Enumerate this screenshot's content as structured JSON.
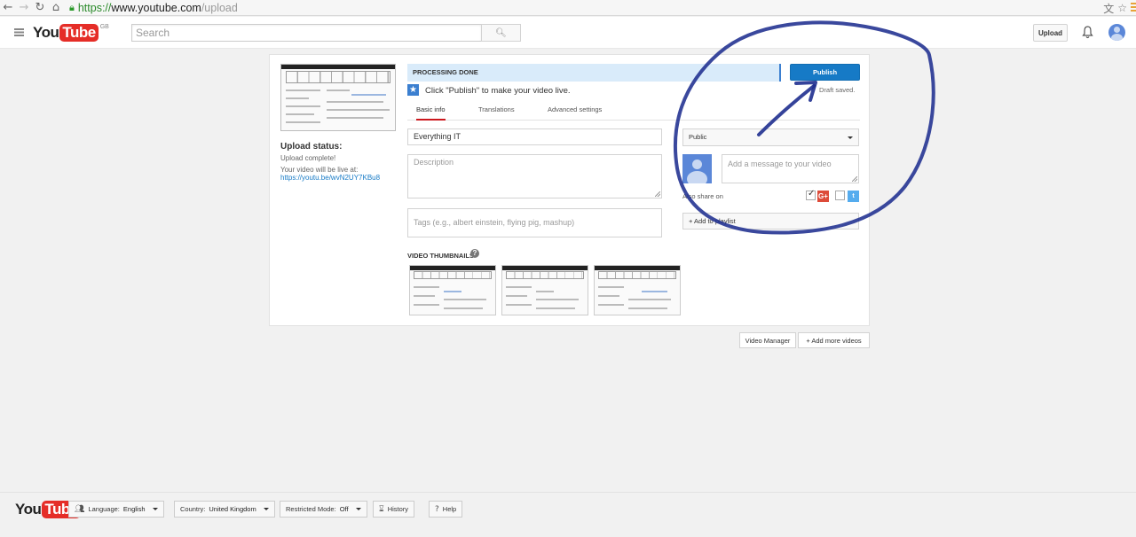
{
  "browser": {
    "url_scheme": "https://",
    "url_domain": "www.youtube.com",
    "url_path": "/upload"
  },
  "header": {
    "logo_you": "You",
    "logo_tube": "Tube",
    "logo_region": "GB",
    "search_placeholder": "Search",
    "upload_label": "Upload"
  },
  "upload": {
    "status_title": "Upload status:",
    "status_text": "Upload complete!",
    "live_text": "Your video will be live at:",
    "video_link": "https://youtu.be/wvN2UY7KBu8",
    "progress_text": "PROCESSING DONE",
    "publish_label": "Publish",
    "draft_text": "Draft saved.",
    "hint_text": "Click \"Publish\" to make your video live.",
    "tabs": [
      "Basic info",
      "Translations",
      "Advanced settings"
    ],
    "title_value": "Everything IT",
    "description_placeholder": "Description",
    "tags_placeholder": "Tags (e.g., albert einstein, flying pig, mashup)",
    "privacy_value": "Public",
    "message_placeholder": "Add a message to your video",
    "also_share_label": "Also share on",
    "gplus_label": "G+",
    "twitter_label": "t",
    "playlist_label": "+ Add to playlist",
    "thumbnails_label": "VIDEO THUMBNAILS",
    "thumbnails_help": "?"
  },
  "actions": {
    "video_manager": "Video Manager",
    "add_more": "+ Add more videos"
  },
  "footer": {
    "language_label": "Language:",
    "language_value": "English",
    "country_label": "Country:",
    "country_value": "United Kingdom",
    "restricted_label": "Restricted Mode:",
    "restricted_value": "Off",
    "history_label": "History",
    "help_label": "Help"
  },
  "colors": {
    "youtube_red": "#e52d27",
    "publish_blue": "#167ac6",
    "progress_bg": "#d9ebfa",
    "annotation_ink": "#1f2f8f"
  }
}
